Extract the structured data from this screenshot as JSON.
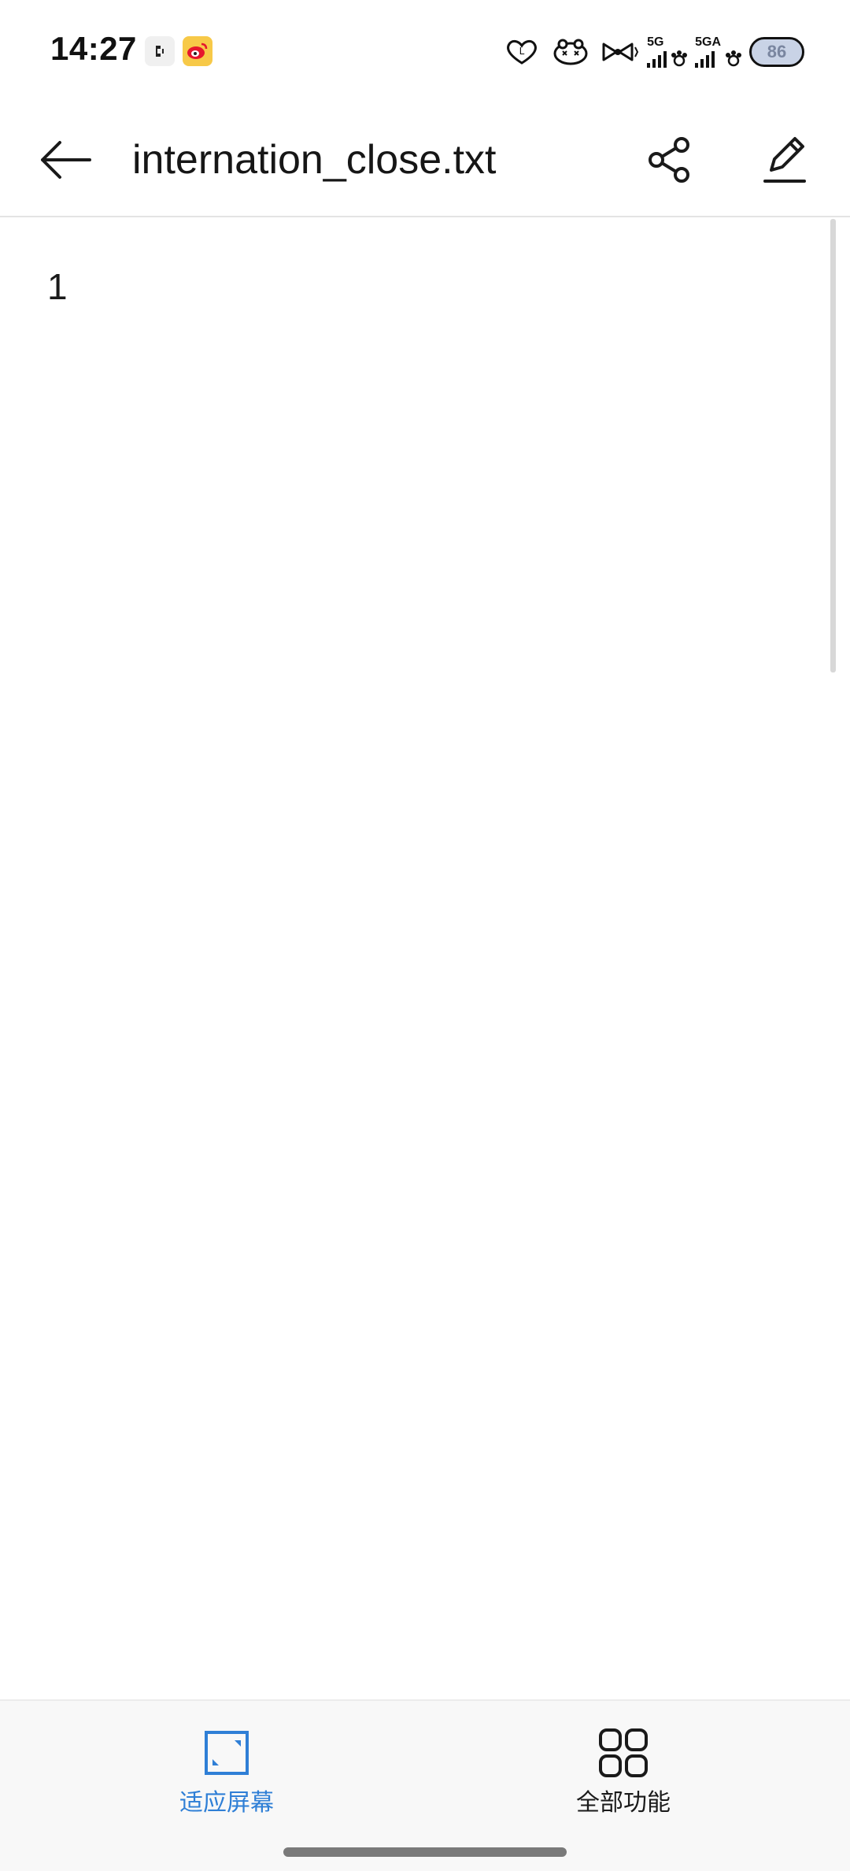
{
  "status_bar": {
    "time": "14:27",
    "network_1": "5G",
    "network_2": "5GA",
    "battery": "86"
  },
  "app_bar": {
    "title": "internation_close.txt",
    "icons": [
      "back-arrow-icon",
      "share-icon",
      "edit-pencil-icon"
    ]
  },
  "content": {
    "text": "1"
  },
  "bottom_bar": {
    "fit_screen_label": "适应屏幕",
    "all_features_label": "全部功能"
  },
  "colors": {
    "accent": "#2f7fd6",
    "text": "#1a1a1a",
    "toolbar_bg": "#f8f8f8"
  }
}
